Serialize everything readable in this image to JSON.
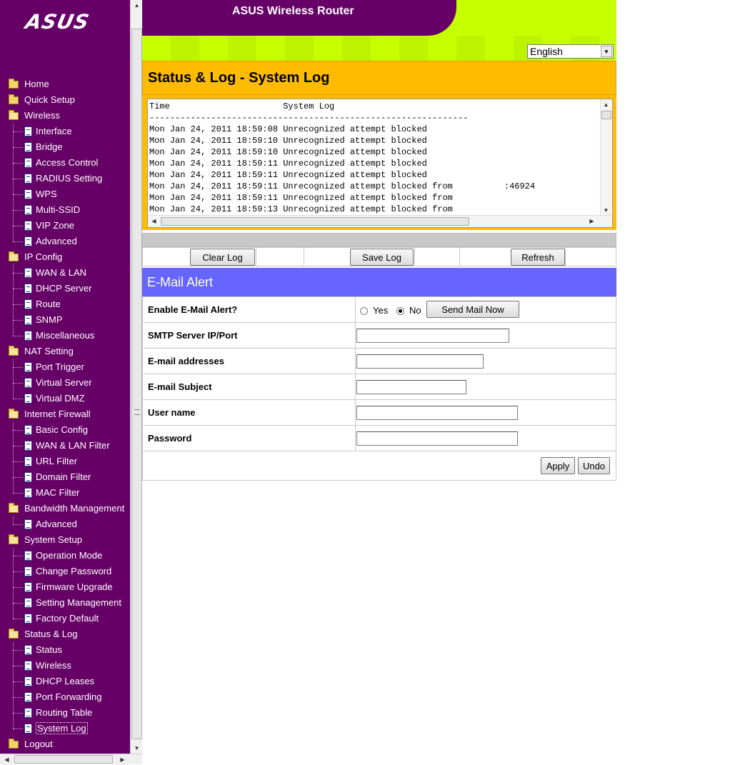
{
  "logo": {
    "text": "ASUS"
  },
  "banner": {
    "title": "ASUS Wireless Router"
  },
  "language": {
    "selected": "English"
  },
  "page_title": "Status & Log - System Log",
  "log": {
    "content": "Time                      System Log\n--------------------------------------------------------------\nMon Jan 24, 2011 18:59:08 Unrecognized attempt blocked\nMon Jan 24, 2011 18:59:10 Unrecognized attempt blocked\nMon Jan 24, 2011 18:59:10 Unrecognized attempt blocked\nMon Jan 24, 2011 18:59:11 Unrecognized attempt blocked\nMon Jan 24, 2011 18:59:11 Unrecognized attempt blocked\nMon Jan 24, 2011 18:59:11 Unrecognized attempt blocked from          :46924\nMon Jan 24, 2011 18:59:11 Unrecognized attempt blocked from\nMon Jan 24, 2011 18:59:13 Unrecognized attempt blocked from"
  },
  "buttons": {
    "clear_log": "Clear Log",
    "save_log": "Save Log",
    "refresh": "Refresh",
    "send_mail": "Send Mail Now",
    "apply": "Apply",
    "undo": "Undo"
  },
  "email_alert": {
    "title": "E-Mail Alert",
    "enable_label": "Enable E-Mail Alert?",
    "yes_label": "Yes",
    "no_label": "No",
    "enabled": "No",
    "smtp_label": "SMTP Server IP/Port",
    "smtp_value": "",
    "addresses_label": "E-mail addresses",
    "addresses_value": "",
    "subject_label": "E-mail Subject",
    "subject_value": "",
    "username_label": "User name",
    "username_value": "",
    "password_label": "Password",
    "password_value": ""
  },
  "nav": {
    "items": [
      {
        "label": "Home",
        "level": 0,
        "icon": "folder-icon"
      },
      {
        "label": "Quick Setup",
        "level": 0,
        "icon": "folder-icon"
      },
      {
        "label": "Wireless",
        "level": 0,
        "icon": "folder-open-icon"
      },
      {
        "label": "Interface",
        "level": 1,
        "icon": "page-icon"
      },
      {
        "label": "Bridge",
        "level": 1,
        "icon": "page-icon"
      },
      {
        "label": "Access Control",
        "level": 1,
        "icon": "page-icon"
      },
      {
        "label": "RADIUS Setting",
        "level": 1,
        "icon": "page-icon"
      },
      {
        "label": "WPS",
        "level": 1,
        "icon": "page-icon"
      },
      {
        "label": "Multi-SSID",
        "level": 1,
        "icon": "page-icon"
      },
      {
        "label": "VIP Zone",
        "level": 1,
        "icon": "page-icon"
      },
      {
        "label": "Advanced",
        "level": 1,
        "icon": "page-icon"
      },
      {
        "label": "IP Config",
        "level": 0,
        "icon": "folder-open-icon"
      },
      {
        "label": "WAN & LAN",
        "level": 1,
        "icon": "page-icon"
      },
      {
        "label": "DHCP Server",
        "level": 1,
        "icon": "page-icon"
      },
      {
        "label": "Route",
        "level": 1,
        "icon": "page-icon"
      },
      {
        "label": "SNMP",
        "level": 1,
        "icon": "page-icon"
      },
      {
        "label": "Miscellaneous",
        "level": 1,
        "icon": "page-icon"
      },
      {
        "label": "NAT Setting",
        "level": 0,
        "icon": "folder-open-icon"
      },
      {
        "label": "Port Trigger",
        "level": 1,
        "icon": "page-icon"
      },
      {
        "label": "Virtual Server",
        "level": 1,
        "icon": "page-icon"
      },
      {
        "label": "Virtual DMZ",
        "level": 1,
        "icon": "page-icon"
      },
      {
        "label": "Internet Firewall",
        "level": 0,
        "icon": "folder-open-icon"
      },
      {
        "label": "Basic Config",
        "level": 1,
        "icon": "page-icon"
      },
      {
        "label": "WAN & LAN Filter",
        "level": 1,
        "icon": "page-icon"
      },
      {
        "label": "URL Filter",
        "level": 1,
        "icon": "page-icon"
      },
      {
        "label": "Domain Filter",
        "level": 1,
        "icon": "page-icon"
      },
      {
        "label": "MAC Filter",
        "level": 1,
        "icon": "page-icon"
      },
      {
        "label": "Bandwidth Management",
        "level": 0,
        "icon": "folder-open-icon"
      },
      {
        "label": "Advanced",
        "level": 1,
        "icon": "page-icon"
      },
      {
        "label": "System Setup",
        "level": 0,
        "icon": "folder-open-icon"
      },
      {
        "label": "Operation Mode",
        "level": 1,
        "icon": "page-icon"
      },
      {
        "label": "Change Password",
        "level": 1,
        "icon": "page-icon"
      },
      {
        "label": "Firmware Upgrade",
        "level": 1,
        "icon": "page-icon"
      },
      {
        "label": "Setting Management",
        "level": 1,
        "icon": "page-icon"
      },
      {
        "label": "Factory Default",
        "level": 1,
        "icon": "page-icon"
      },
      {
        "label": "Status & Log",
        "level": 0,
        "icon": "folder-open-icon"
      },
      {
        "label": "Status",
        "level": 1,
        "icon": "page-icon"
      },
      {
        "label": "Wireless",
        "level": 1,
        "icon": "page-icon"
      },
      {
        "label": "DHCP Leases",
        "level": 1,
        "icon": "page-icon"
      },
      {
        "label": "Port Forwarding",
        "level": 1,
        "icon": "page-icon"
      },
      {
        "label": "Routing Table",
        "level": 1,
        "icon": "page-icon"
      },
      {
        "label": "System Log",
        "level": 1,
        "icon": "page-icon",
        "selected": true
      },
      {
        "label": "Logout",
        "level": 0,
        "icon": "folder-icon"
      }
    ]
  }
}
